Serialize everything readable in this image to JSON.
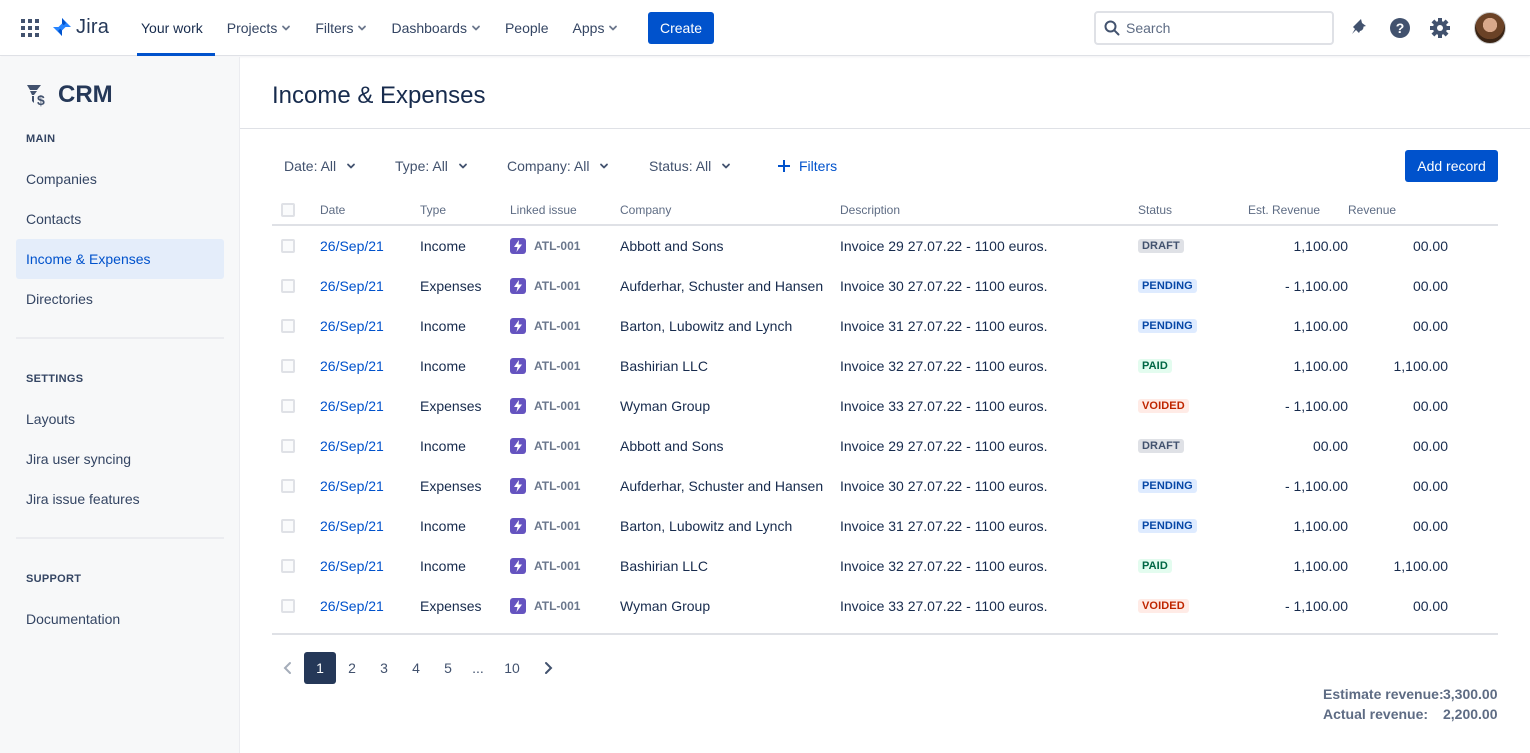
{
  "topbar": {
    "logo_text": "Jira",
    "nav": [
      {
        "label": "Your work",
        "active": true,
        "dropdown": false
      },
      {
        "label": "Projects",
        "dropdown": true
      },
      {
        "label": "Filters",
        "dropdown": true
      },
      {
        "label": "Dashboards",
        "dropdown": true
      },
      {
        "label": "People",
        "dropdown": false
      },
      {
        "label": "Apps",
        "dropdown": true
      }
    ],
    "create_label": "Create",
    "search_placeholder": "Search",
    "icons": [
      "notifications-icon",
      "help-icon",
      "settings-icon"
    ]
  },
  "sidebar": {
    "project_name": "CRM",
    "sections": [
      {
        "title": "MAIN",
        "items": [
          "Companies",
          "Contacts",
          "Income & Expenses",
          "Directories"
        ]
      },
      {
        "title": "SETTINGS",
        "items": [
          "Layouts",
          "Jira user syncing",
          "Jira issue features"
        ]
      },
      {
        "title": "SUPPORT",
        "items": [
          "Documentation"
        ]
      }
    ],
    "active_item": "Income & Expenses"
  },
  "page": {
    "title": "Income & Expenses",
    "filters": [
      "Date: All",
      "Type: All",
      "Company: All",
      "Status: All"
    ],
    "add_filter_label": "Filters",
    "add_record_label": "Add record"
  },
  "table": {
    "columns": [
      "Date",
      "Type",
      "Linked issue",
      "Company",
      "Description",
      "Status",
      "Est. Revenue",
      "Revenue"
    ],
    "rows": [
      {
        "date": "26/Sep/21",
        "type": "Income",
        "issue": "ATL-001",
        "company": "Abbott and Sons",
        "description": "Invoice 29 27.07.22 - 1100 euros.",
        "status": "DRAFT",
        "est": "1,100.00",
        "rev": "00.00"
      },
      {
        "date": "26/Sep/21",
        "type": "Expenses",
        "issue": "ATL-001",
        "company": "Aufderhar, Schuster and Hansen",
        "description": "Invoice 30 27.07.22 - 1100 euros.",
        "status": "PENDING",
        "est": "- 1,100.00",
        "rev": "00.00"
      },
      {
        "date": "26/Sep/21",
        "type": "Income",
        "issue": "ATL-001",
        "company": "Barton, Lubowitz and Lynch",
        "description": "Invoice 31 27.07.22 - 1100 euros.",
        "status": "PENDING",
        "est": "1,100.00",
        "rev": "00.00"
      },
      {
        "date": "26/Sep/21",
        "type": "Income",
        "issue": "ATL-001",
        "company": "Bashirian LLC",
        "description": "Invoice 32 27.07.22 - 1100 euros.",
        "status": "PAID",
        "est": "1,100.00",
        "rev": "1,100.00"
      },
      {
        "date": "26/Sep/21",
        "type": "Expenses",
        "issue": "ATL-001",
        "company": "Wyman Group",
        "description": "Invoice 33 27.07.22 - 1100 euros.",
        "status": "VOIDED",
        "est": "- 1,100.00",
        "rev": "00.00"
      },
      {
        "date": "26/Sep/21",
        "type": "Income",
        "issue": "ATL-001",
        "company": "Abbott and Sons",
        "description": "Invoice 29 27.07.22 - 1100 euros.",
        "status": "DRAFT",
        "est": "00.00",
        "rev": "00.00"
      },
      {
        "date": "26/Sep/21",
        "type": "Expenses",
        "issue": "ATL-001",
        "company": "Aufderhar, Schuster and Hansen",
        "description": "Invoice 30 27.07.22 - 1100 euros.",
        "status": "PENDING",
        "est": "- 1,100.00",
        "rev": "00.00"
      },
      {
        "date": "26/Sep/21",
        "type": "Income",
        "issue": "ATL-001",
        "company": "Barton, Lubowitz and Lynch",
        "description": "Invoice 31 27.07.22 - 1100 euros.",
        "status": "PENDING",
        "est": "1,100.00",
        "rev": "00.00"
      },
      {
        "date": "26/Sep/21",
        "type": "Income",
        "issue": "ATL-001",
        "company": "Bashirian LLC",
        "description": "Invoice 32 27.07.22 - 1100 euros.",
        "status": "PAID",
        "est": "1,100.00",
        "rev": "1,100.00"
      },
      {
        "date": "26/Sep/21",
        "type": "Expenses",
        "issue": "ATL-001",
        "company": "Wyman Group",
        "description": "Invoice 33 27.07.22 - 1100 euros.",
        "status": "VOIDED",
        "est": "- 1,100.00",
        "rev": "00.00"
      }
    ]
  },
  "status_colors": {
    "DRAFT": {
      "bg": "#dfe1e6",
      "fg": "#42526e"
    },
    "PENDING": {
      "bg": "#deebff",
      "fg": "#0747a6"
    },
    "PAID": {
      "bg": "#e3fcef",
      "fg": "#006644"
    },
    "VOIDED": {
      "bg": "#ffebe6",
      "fg": "#bf2600"
    }
  },
  "pagination": {
    "pages": [
      "1",
      "2",
      "3",
      "4",
      "5",
      "...",
      "10"
    ],
    "current": "1"
  },
  "totals": {
    "estimate_label": "Estimate revenue:",
    "estimate_value": "3,300.00",
    "actual_label": "Actual revenue:",
    "actual_value": "2,200.00"
  }
}
